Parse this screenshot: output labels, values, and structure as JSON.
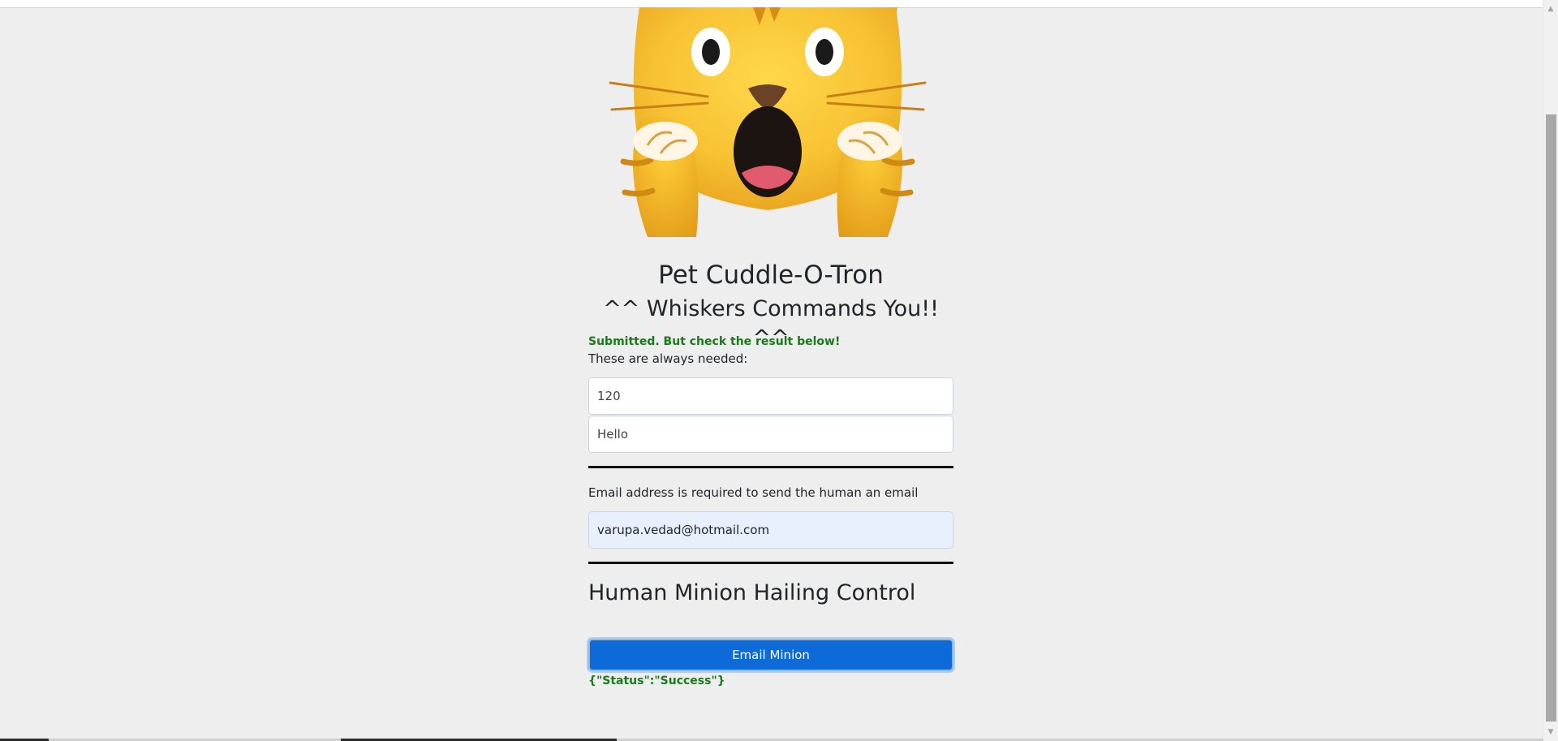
{
  "app": {
    "title": "Pet Cuddle-O-Tron",
    "subtitle": "^^ Whiskers Commands You!! ^^"
  },
  "status": {
    "message": "Submitted. But check the result below!",
    "color": "#1a7a1a"
  },
  "form": {
    "required_note": "These are always needed:",
    "delay_value": "120",
    "message_value": "Hello",
    "email_note": "Email address is required to send the human an email",
    "email_value": "varupa.vedad@hotmail.com"
  },
  "control": {
    "heading": "Human Minion Hailing Control",
    "button_label": "Email Minion",
    "result": "{\"Status\":\"Success\"}"
  },
  "icons": {
    "cat": "screaming-cat-icon"
  },
  "colors": {
    "accent": "#0d6ad8",
    "success": "#1a7a1a",
    "background": "#eeeeee"
  }
}
